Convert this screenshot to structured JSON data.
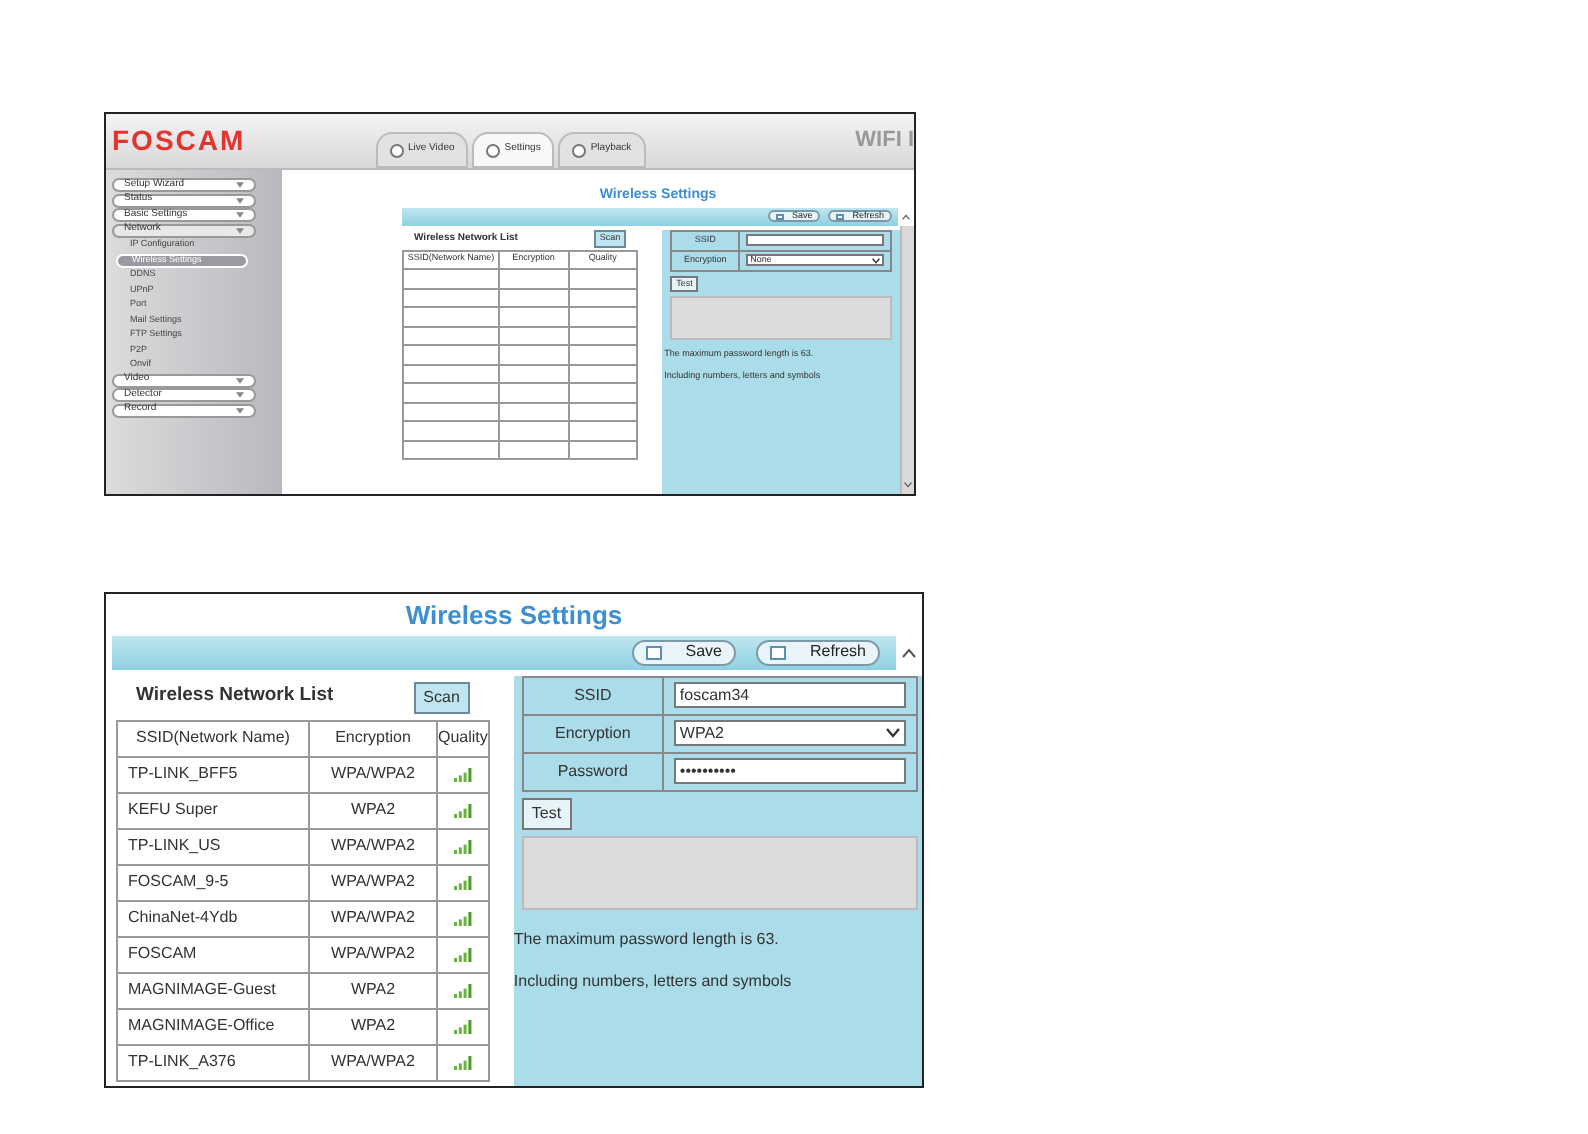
{
  "overview": {
    "logo": "FOSCAM",
    "tabs": [
      {
        "label": "Live Video",
        "selected": false
      },
      {
        "label": "Settings",
        "selected": true
      },
      {
        "label": "Playback",
        "selected": false
      }
    ],
    "product": "WIFI I",
    "sidebar": [
      {
        "label": "Setup Wizard",
        "expanded": false
      },
      {
        "label": "Status",
        "expanded": false
      },
      {
        "label": "Basic Settings",
        "expanded": false
      },
      {
        "label": "Network",
        "expanded": true,
        "children": [
          {
            "label": "IP Configuration",
            "selected": false
          },
          {
            "label": "Wireless Settings",
            "selected": true
          },
          {
            "label": "DDNS",
            "selected": false
          },
          {
            "label": "UPnP",
            "selected": false
          },
          {
            "label": "Port",
            "selected": false
          },
          {
            "label": "Mail Settings",
            "selected": false
          },
          {
            "label": "FTP Settings",
            "selected": false
          },
          {
            "label": "P2P",
            "selected": false
          },
          {
            "label": "Onvif",
            "selected": false
          }
        ]
      },
      {
        "label": "Video",
        "expanded": false
      },
      {
        "label": "Detector",
        "expanded": false
      },
      {
        "label": "Record",
        "expanded": false
      }
    ],
    "panel": {
      "title": "Wireless Settings",
      "save": "Save",
      "refresh": "Refresh",
      "list_title": "Wireless Network List",
      "scan": "Scan",
      "columns": [
        "SSID(Network Name)",
        "Encryption",
        "Quality"
      ],
      "fields": [
        {
          "label": "SSID",
          "kind": "text"
        },
        {
          "label": "Encryption",
          "kind": "select",
          "value": "None"
        }
      ],
      "test": "Test",
      "notes": [
        "The maximum password length is 63.",
        "Including numbers, letters and symbols"
      ]
    }
  },
  "detail": {
    "panel": {
      "title": "Wireless Settings",
      "save": "Save",
      "refresh": "Refresh",
      "list_title": "Wireless Network List",
      "scan": "Scan",
      "columns": [
        "SSID(Network Name)",
        "Encryption",
        "Quality"
      ],
      "rows": [
        {
          "ssid": "TP-LINK_BFF5",
          "encryption": "WPA/WPA2"
        },
        {
          "ssid": "KEFU Super",
          "encryption": "WPA2"
        },
        {
          "ssid": "TP-LINK_US",
          "encryption": "WPA/WPA2"
        },
        {
          "ssid": "FOSCAM_9-5",
          "encryption": "WPA/WPA2"
        },
        {
          "ssid": "ChinaNet-4Ydb",
          "encryption": "WPA/WPA2"
        },
        {
          "ssid": "FOSCAM",
          "encryption": "WPA/WPA2"
        },
        {
          "ssid": "MAGNIMAGE-Guest",
          "encryption": "WPA2"
        },
        {
          "ssid": "MAGNIMAGE-Office",
          "encryption": "WPA2"
        },
        {
          "ssid": "TP-LINK_A376",
          "encryption": "WPA/WPA2"
        }
      ],
      "fields": [
        {
          "label": "SSID",
          "kind": "text",
          "value": "foscam34"
        },
        {
          "label": "Encryption",
          "kind": "select",
          "value": "WPA2"
        },
        {
          "label": "Password",
          "kind": "password",
          "value": "••••••••••"
        }
      ],
      "test": "Test",
      "notes": [
        "The maximum password length is 63.",
        "Including numbers, letters and symbols"
      ]
    }
  }
}
